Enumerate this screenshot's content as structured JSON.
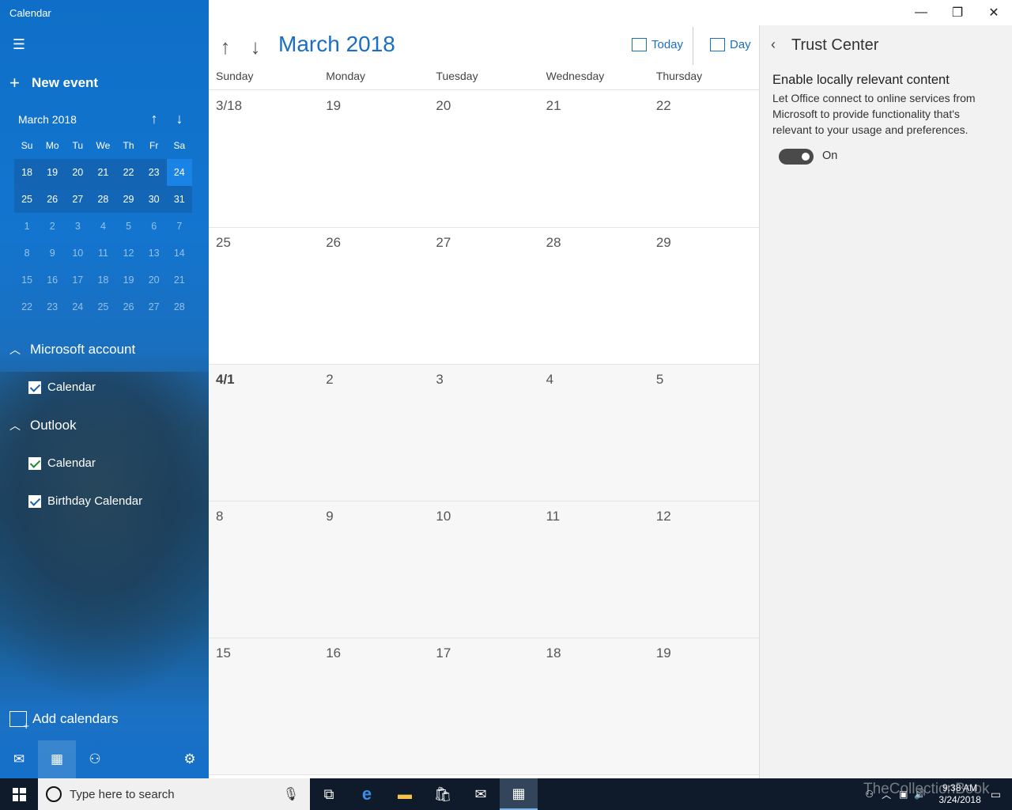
{
  "app": {
    "title": "Calendar"
  },
  "sidebar": {
    "new_event": "New event",
    "mini": {
      "month": "March 2018",
      "dow": [
        "Su",
        "Mo",
        "Tu",
        "We",
        "Th",
        "Fr",
        "Sa"
      ],
      "weeks": [
        [
          "18",
          "19",
          "20",
          "21",
          "22",
          "23",
          "24"
        ],
        [
          "25",
          "26",
          "27",
          "28",
          "29",
          "30",
          "31"
        ],
        [
          "1",
          "2",
          "3",
          "4",
          "5",
          "6",
          "7"
        ],
        [
          "8",
          "9",
          "10",
          "11",
          "12",
          "13",
          "14"
        ],
        [
          "15",
          "16",
          "17",
          "18",
          "19",
          "20",
          "21"
        ],
        [
          "22",
          "23",
          "24",
          "25",
          "26",
          "27",
          "28"
        ]
      ]
    },
    "accounts": [
      {
        "name": "Microsoft account",
        "calendars": [
          "Calendar"
        ]
      },
      {
        "name": "Outlook",
        "calendars": [
          "Calendar",
          "Birthday Calendar"
        ]
      }
    ],
    "add_calendars": "Add calendars"
  },
  "main": {
    "month_title": "March 2018",
    "today_label": "Today",
    "day_label": "Day",
    "dow": [
      "Sunday",
      "Monday",
      "Tuesday",
      "Wednesday",
      "Thursday"
    ],
    "weeks": [
      [
        "3/18",
        "19",
        "20",
        "21",
        "22"
      ],
      [
        "25",
        "26",
        "27",
        "28",
        "29"
      ],
      [
        "4/1",
        "2",
        "3",
        "4",
        "5"
      ],
      [
        "8",
        "9",
        "10",
        "11",
        "12"
      ],
      [
        "15",
        "16",
        "17",
        "18",
        "19"
      ]
    ]
  },
  "pane": {
    "title": "Trust Center",
    "heading": "Enable locally relevant content",
    "description": "Let Office connect to online services from Microsoft to provide functionality that's relevant to your usage and preferences.",
    "toggle_label": "On",
    "toggle_on": true
  },
  "taskbar": {
    "search_placeholder": "Type here to search",
    "time": "9:38 AM",
    "date": "3/24/2018"
  },
  "watermark": "TheCollectionBook"
}
